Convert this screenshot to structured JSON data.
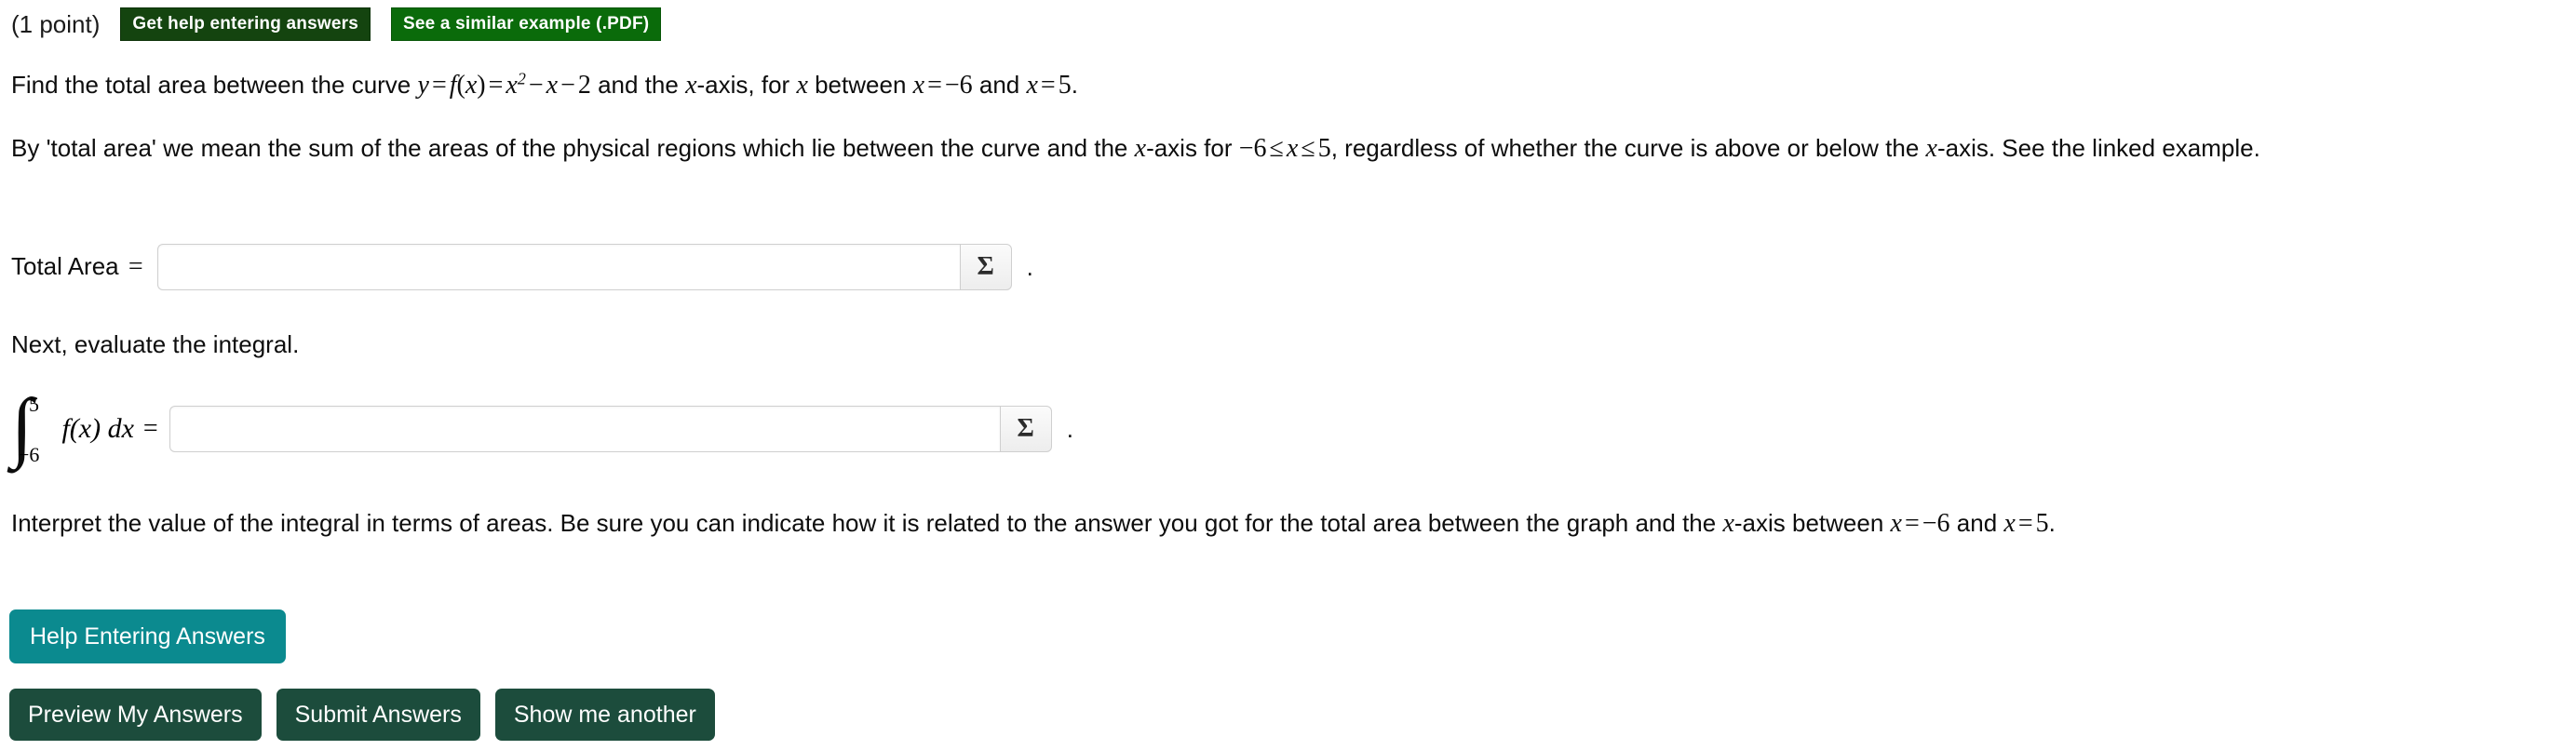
{
  "header": {
    "points": "(1 point)",
    "help_badge": "Get help entering answers",
    "example_badge": "See a similar example (.PDF)"
  },
  "problem": {
    "line1": {
      "pre": "Find the total area between the curve ",
      "math_y": "y",
      "eq1": "=",
      "math_f": "f",
      "paren_open": "(",
      "math_x1": "x",
      "paren_close": ")",
      "eq2": "=",
      "math_x2": "x",
      "exp2": "2",
      "minus1": "−",
      "math_x3": "x",
      "minus2": "−",
      "num2": "2",
      "mid": " and the ",
      "math_x4": "x",
      "mid2": "-axis, for ",
      "math_x5": "x",
      "mid3": " between ",
      "math_x6": "x",
      "eq3": "=",
      "neg6": "−6",
      "mid4": " and ",
      "math_x7": "x",
      "eq4": "=",
      "num5": "5",
      "period": "."
    },
    "line2": {
      "pre": "By 'total area' we mean the sum of the areas of the physical regions which lie between the curve and the ",
      "math_x1": "x",
      "mid1": "-axis for ",
      "neg6": "−6",
      "le1": "≤",
      "math_x2": "x",
      "le2": "≤",
      "num5": "5",
      "mid2": ", regardless of whether the curve is above or below the ",
      "math_x3": "x",
      "tail": "-axis. See the linked example."
    },
    "next_instruction": "Next, evaluate the integral.",
    "interpret": {
      "pre": "Interpret the value of the integral in terms of areas. Be sure you can indicate how it is related to the answer you got for the total area between the graph and the ",
      "math_x1": "x",
      "mid1": "-axis between ",
      "math_x2": "x",
      "eq1": "=",
      "neg6": "−6",
      "mid2": " and ",
      "math_x3": "x",
      "eq2": "=",
      "num5": "5",
      "period": "."
    }
  },
  "answers": {
    "total_area": {
      "label": "Total Area",
      "equals": "=",
      "value": "",
      "placeholder": "",
      "sigma_label": "Σ",
      "sigma_icon": "sigma-icon",
      "trailing": "."
    },
    "integral": {
      "integral_sign": "∫",
      "upper_limit": "5",
      "lower_limit": "−6",
      "integrand": "f(x) dx",
      "equals": "=",
      "value": "",
      "placeholder": "",
      "sigma_label": "Σ",
      "sigma_icon": "sigma-icon",
      "trailing": "."
    }
  },
  "buttons": {
    "help_entering_answers": "Help Entering Answers",
    "preview": "Preview My Answers",
    "submit": "Submit Answers",
    "show_another": "Show me another"
  },
  "colors": {
    "badge_dark_green": "#14440f",
    "badge_bright_green": "#0a6b0a",
    "teal_button": "#0b8a8f",
    "dark_green_button": "#1c4c3c",
    "page_background": "#ffffff",
    "text": "#0d0d0d"
  }
}
